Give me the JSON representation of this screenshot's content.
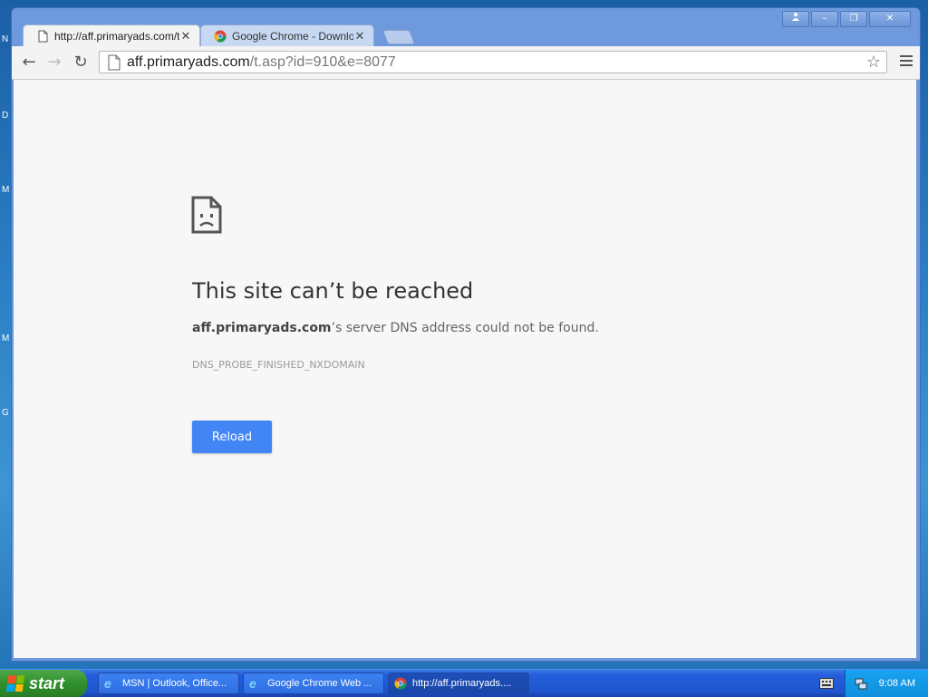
{
  "desktop": {
    "edge_letters": [
      "N",
      "D",
      "M",
      "M",
      "G"
    ]
  },
  "window": {
    "caption_buttons": [
      "user",
      "minimize",
      "restore",
      "close"
    ]
  },
  "tabs": [
    {
      "title": "http://aff.primaryads.com/t.",
      "active": true
    },
    {
      "title": "Google Chrome - Download t",
      "active": false
    }
  ],
  "toolbar": {
    "url_host": "aff.primaryads.com",
    "url_path": "/t.asp?id=910&e=8077"
  },
  "error": {
    "title": "This site can’t be reached",
    "host": "aff.primaryads.com",
    "desc_suffix": "’s server DNS address could not be found.",
    "code": "DNS_PROBE_FINISHED_NXDOMAIN",
    "reload_label": "Reload"
  },
  "taskbar": {
    "start_label": "start",
    "items": [
      {
        "label": "MSN | Outlook, Office...",
        "icon": "ie-icon"
      },
      {
        "label": "Google Chrome Web ...",
        "icon": "ie-icon"
      },
      {
        "label": "http://aff.primaryads....",
        "icon": "chrome-icon"
      }
    ],
    "clock": "9:08 AM"
  },
  "colors": {
    "accent": "#4285f4",
    "content_bg": "#f7f7f7",
    "taskbar": "#245edb",
    "start_green": "#2f8f2c"
  }
}
